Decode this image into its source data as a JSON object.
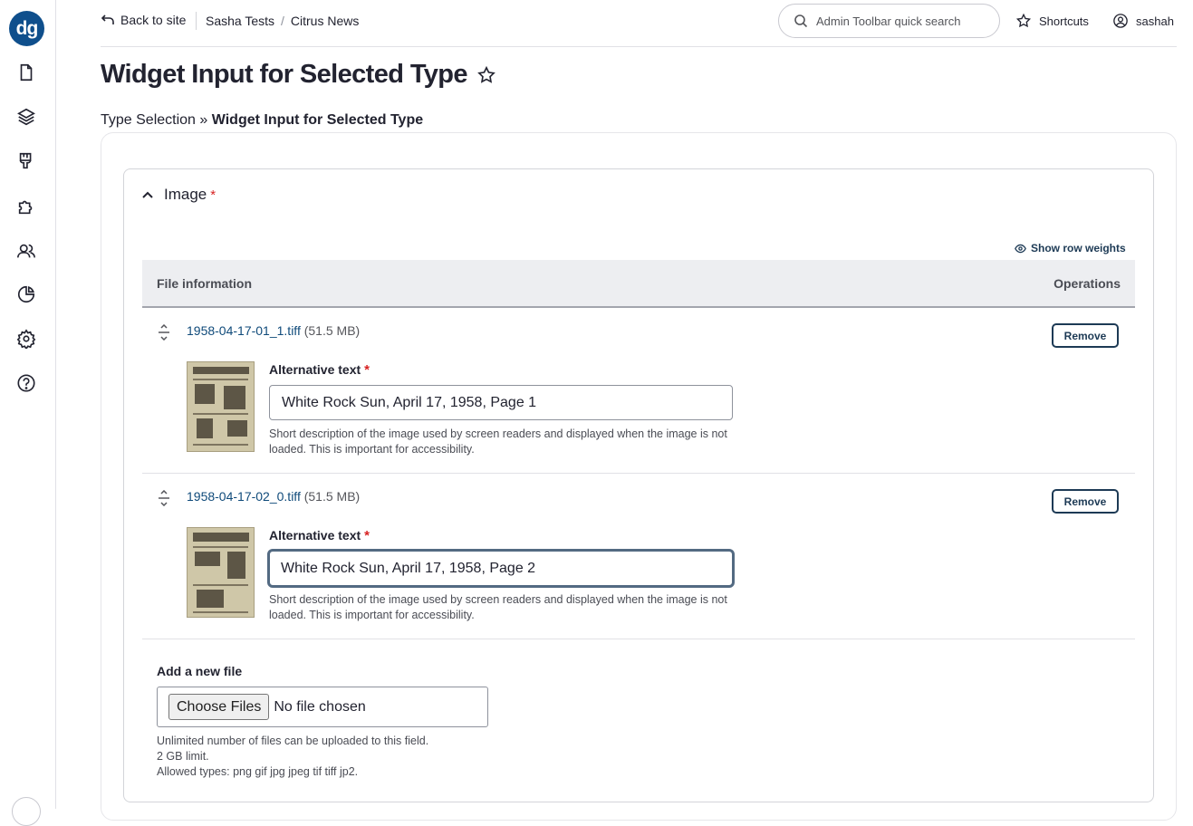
{
  "sidebar": {
    "logo_text": "dg",
    "logo_color": "#0f4f8c",
    "items": [
      {
        "icon": "file-icon"
      },
      {
        "icon": "layers-icon"
      },
      {
        "icon": "paintbrush-icon"
      },
      {
        "icon": "puzzle-icon"
      },
      {
        "icon": "users-icon"
      },
      {
        "icon": "pie-chart-icon"
      },
      {
        "icon": "gear-icon"
      },
      {
        "icon": "help-icon"
      }
    ]
  },
  "topbar": {
    "back_label": "Back to site",
    "breadcrumbs": [
      "Sasha Tests",
      "Citrus News"
    ],
    "search_placeholder": "Admin Toolbar quick search",
    "shortcuts_label": "Shortcuts",
    "username": "sashah"
  },
  "page": {
    "title": "Widget Input for Selected Type",
    "flow_step_1": "Type Selection",
    "flow_separator": "»",
    "flow_step_2": "Widget Input for Selected Type"
  },
  "field": {
    "legend": "Image",
    "required_marker": "*",
    "show_row_weights": "Show row weights",
    "col_file_info": "File information",
    "col_operations": "Operations",
    "files": [
      {
        "name": "1958-04-17-01_1.tiff",
        "size": "(51.5 MB)",
        "remove_label": "Remove",
        "alt_label": "Alternative text",
        "alt_value": "White Rock Sun, April 17, 1958, Page 1",
        "alt_desc": "Short description of the image used by screen readers and displayed when the image is not loaded. This is important for accessibility."
      },
      {
        "name": "1958-04-17-02_0.tiff",
        "size": "(51.5 MB)",
        "remove_label": "Remove",
        "alt_label": "Alternative text",
        "alt_value": "White Rock Sun, April 17, 1958, Page 2",
        "alt_desc": "Short description of the image used by screen readers and displayed when the image is not loaded. This is important for accessibility."
      }
    ],
    "add_label": "Add a new file",
    "choose_label": "Choose Files",
    "no_file_label": "No file chosen",
    "upload_desc_1": "Unlimited number of files can be uploaded to this field.",
    "upload_desc_2": "2 GB limit.",
    "upload_desc_3": "Allowed types: png gif jpg jpeg tif tiff jp2."
  }
}
